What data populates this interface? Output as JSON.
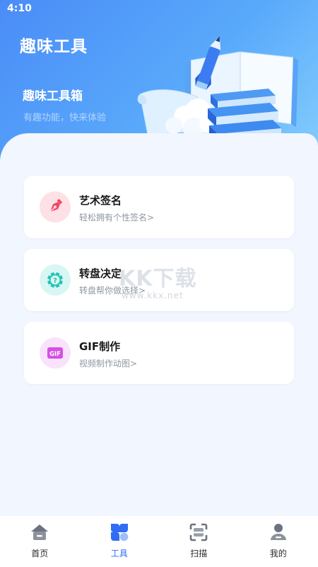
{
  "status_bar": {
    "time": "4:10"
  },
  "header": {
    "title": "趣味工具",
    "subtitle": "趣味工具箱",
    "description": "有趣功能，快来体验"
  },
  "tools": [
    {
      "title": "艺术签名",
      "desc": "轻松拥有个性签名>",
      "icon": "pen-nib-icon",
      "icon_bg": "#fde1e6",
      "icon_color": "#f2495f"
    },
    {
      "title": "转盘决定",
      "desc": "转盘帮你做选择>",
      "icon": "wheel-icon",
      "icon_bg": "#d8f6f3",
      "icon_color": "#22c3b2"
    },
    {
      "title": "GIF制作",
      "desc": "视频制作动图>",
      "icon": "gif-icon",
      "icon_bg": "#f9e2fb",
      "icon_color": "#d650e6"
    }
  ],
  "watermark": {
    "text": "KK下载",
    "url": "www.kkx.net"
  },
  "bottom_nav": [
    {
      "label": "首页",
      "icon": "home-icon",
      "active": false
    },
    {
      "label": "工具",
      "icon": "tools-grid-icon",
      "active": true
    },
    {
      "label": "扫描",
      "icon": "scan-icon",
      "active": false
    },
    {
      "label": "我的",
      "icon": "profile-icon",
      "active": false
    }
  ],
  "colors": {
    "accent": "#2f6df4",
    "header_blue": "#4a8cf7",
    "background": "#f2f6fe"
  }
}
